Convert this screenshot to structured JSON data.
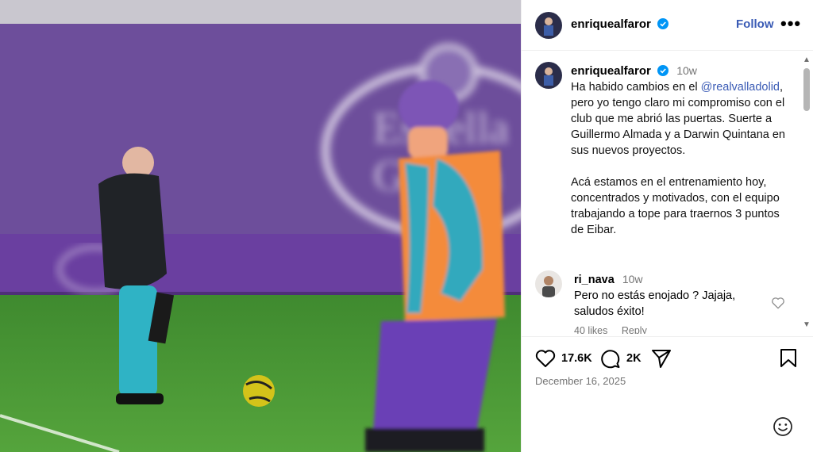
{
  "post": {
    "username": "enriquealfaror",
    "follow_label": "Follow",
    "more_label": "•••"
  },
  "caption": {
    "username": "enriquealfaror",
    "time": "10w",
    "text_part1": "Ha habido cambios en el ",
    "mention": "@realvalladolid",
    "text_part2": ", pero yo tengo claro mi compromiso con el club que me abrió las puertas. Suerte a Guillermo Almada y a Darwin Quintana en sus nuevos proyectos.\n\nAcá estamos en el entrenamiento hoy, concentrados y motivados, con el equipo trabajando a tope para traernos 3 puntos de Eibar."
  },
  "comment": {
    "username": "ri_nava",
    "time": "10w",
    "text": "Pero no estás enojado ? Jajaja,\nsaludos éxito!",
    "likes": "40 likes",
    "reply_label": "Reply"
  },
  "actions": {
    "likes_count": "17.6K",
    "comments_count": "2K"
  },
  "date": "December 16, 2025",
  "colors": {
    "link": "#3a5bb5",
    "verified": "#0095f6",
    "muted": "#737373"
  },
  "icons": [
    "verified-badge-icon",
    "heart-icon",
    "comment-icon",
    "share-icon",
    "bookmark-icon",
    "emoji-icon",
    "more-options-icon",
    "scroll-up-icon",
    "scroll-down-icon"
  ]
}
